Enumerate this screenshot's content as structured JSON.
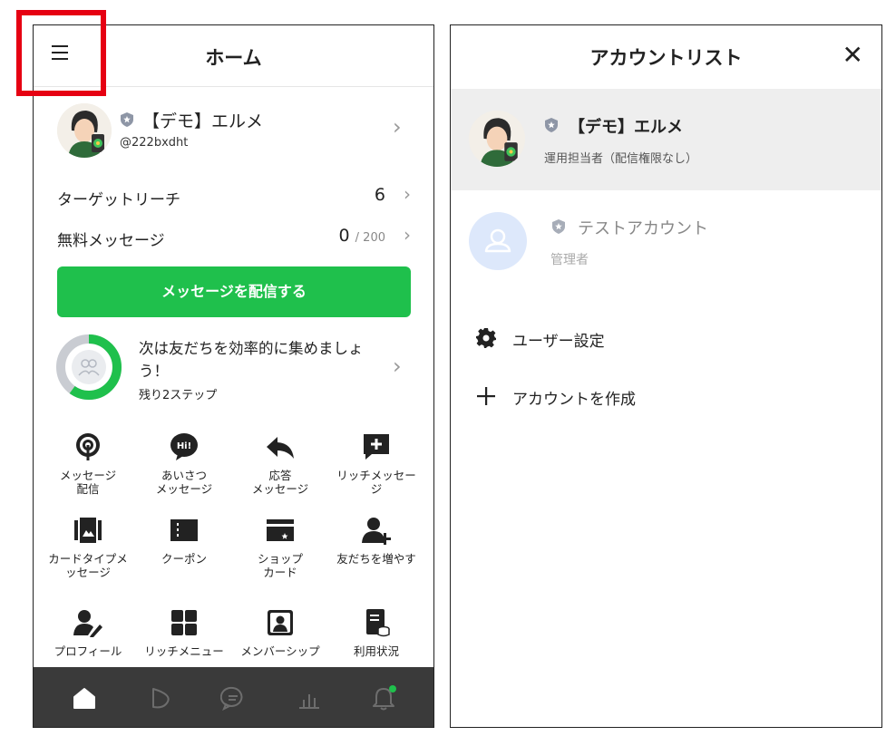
{
  "home": {
    "title": "ホーム",
    "account_name": "【デモ】エルメ",
    "account_id": "@222bxdht",
    "target_reach_label": "ターゲットリーチ",
    "target_reach_value": "6",
    "free_message_label": "無料メッセージ",
    "free_message_value": "0",
    "free_message_limit": "/ 200",
    "send_button": "メッセージを配信する",
    "progress_title": "次は友だちを効率的に集めましょう！",
    "progress_sub": "残り2ステップ",
    "progress_fraction": 0.6,
    "menu": [
      {
        "label": "メッセージ\n配信",
        "icon": "broadcast-icon"
      },
      {
        "label": "あいさつ\nメッセージ",
        "icon": "greeting-icon"
      },
      {
        "label": "応答\nメッセージ",
        "icon": "reply-icon"
      },
      {
        "label": "リッチメッセー\nジ",
        "icon": "rich-message-icon"
      },
      {
        "label": "カードタイプメ\nッセージ",
        "icon": "card-message-icon"
      },
      {
        "label": "クーポン",
        "icon": "coupon-icon"
      },
      {
        "label": "ショップ\nカード",
        "icon": "shop-card-icon"
      },
      {
        "label": "友だちを増やす",
        "icon": "add-friend-icon"
      },
      {
        "label": "プロフィール",
        "icon": "profile-icon"
      },
      {
        "label": "リッチメニュー",
        "icon": "rich-menu-icon"
      },
      {
        "label": "メンバーシップ",
        "icon": "membership-icon"
      },
      {
        "label": "利用状況",
        "icon": "usage-icon"
      }
    ],
    "tabs": [
      "home-tab-icon",
      "timeline-tab-icon",
      "chat-tab-icon",
      "stats-tab-icon",
      "notification-tab-icon"
    ]
  },
  "accounts": {
    "title": "アカウントリスト",
    "close": "✕",
    "selected": {
      "name": "【デモ】エルメ",
      "role": "運用担当者（配信権限なし）"
    },
    "other": {
      "name": "テストアカウント",
      "role": "管理者"
    },
    "user_settings": "ユーザー設定",
    "create_account": "アカウントを作成"
  },
  "colors": {
    "accent_green": "#1fc04c",
    "highlight_red": "#e60012",
    "tabbar": "#3a3a3a"
  }
}
